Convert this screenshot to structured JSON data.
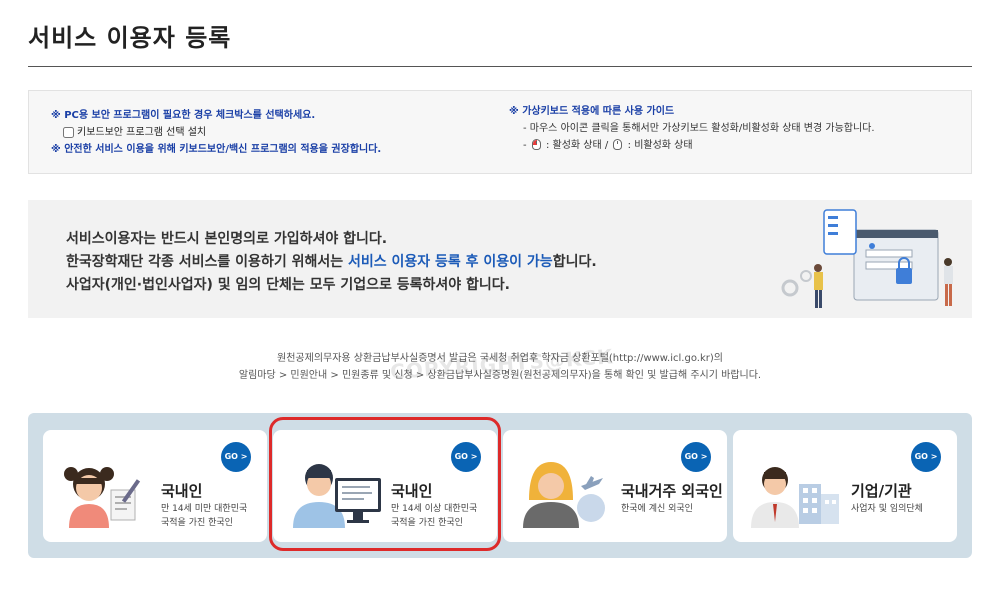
{
  "page": {
    "title": "서비스 이용자 등록"
  },
  "notice": {
    "left": {
      "line1": "※ PC용 보안 프로그램이 필요한 경우 체크박스를 선택하세요.",
      "checkbox_label": "키보드보안 프로그램 선택 설치",
      "line2": "※ 안전한 서비스 이용을 위해 키보드보안/백신 프로그램의 적용을 권장합니다."
    },
    "right": {
      "title": "※ 가상키보드 적용에 따른 사용 가이드",
      "line1": "- 마우스 아이콘 클릭을 통해서만 가상키보드 활성화/비활성화 상태 변경 가능합니다.",
      "bullet": "-",
      "active": ": 활성화 상태 /",
      "inactive": ": 비활성화 상태"
    }
  },
  "info": {
    "line1": "서비스이용자는 반드시 본인명의로 가입하셔야 합니다.",
    "line2_pre": "한국장학재단 각종 서비스를 이용하기 위해서는 ",
    "line2_hl": "서비스 이용자 등록 후 이용이 가능",
    "line2_post": "합니다.",
    "line3": "사업자(개인·법인사업자) 및 임의 단체는 모두 기업으로 등록하셔야 합니다."
  },
  "desc": {
    "line1": "원천공제의무자용 상환금납부사실증명서 발급은 국세청 취업후 학자금 상환포털(http://www.icl.go.kr)의",
    "line2": "알림마당 > 민원안내 > 민원종류 및 신청 > 상환금납부사실증명원(원천공제의무자)을 통해 확인 및 발급해 주시기 바랍니다."
  },
  "watermark": "COPYRIGHTS@KCK",
  "cards": [
    {
      "go": "GO >",
      "name": "국내인",
      "sub1": "만 14세 미만 대한민국",
      "sub2": "국적을 가진 한국인"
    },
    {
      "go": "GO >",
      "name": "국내인",
      "sub1": "만 14세 이상 대한민국",
      "sub2": "국적을 가진 한국인"
    },
    {
      "go": "GO >",
      "name": "국내거주 외국인",
      "sub1": "한국에 계신 외국인",
      "sub2": ""
    },
    {
      "go": "GO >",
      "name": "기업/기관",
      "sub1": "사업자 및 임의단체",
      "sub2": ""
    }
  ],
  "colors": {
    "accent": "#0a64b4",
    "highlight": "#1c5bb8",
    "selection": "#dd2a2a",
    "card_bg": "#cfdde6"
  }
}
